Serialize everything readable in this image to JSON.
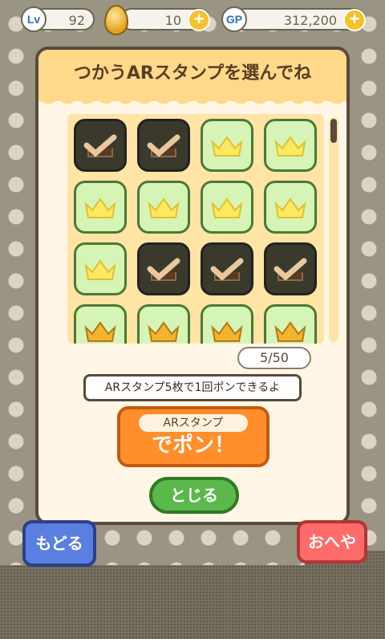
{
  "status": {
    "level_badge": "Lv",
    "level": "92",
    "eggs": "10",
    "gp_badge": "GP",
    "gp": "312,200",
    "plus": "+"
  },
  "dialog": {
    "title": "つかうARスタンプを選んでね",
    "count": "5/50",
    "tip": "ARスタンプ5枚で1回ポンできるよ",
    "pon_sub": "ARスタンプ",
    "pon_main": "でポン！",
    "close": "とじる"
  },
  "stamps": [
    "selected",
    "selected",
    "crown",
    "crown",
    "crown",
    "crown",
    "crown",
    "crown",
    "crown",
    "selected",
    "selected",
    "selected",
    "crown-gold",
    "crown-gold",
    "crown-gold",
    "crown-gold"
  ],
  "nav": {
    "back": "もどる",
    "room": "おへや"
  },
  "colors": {
    "selected": "#3a3a2c",
    "crown_tile": "#d6f4b6",
    "accent": "#ff8e2b"
  }
}
